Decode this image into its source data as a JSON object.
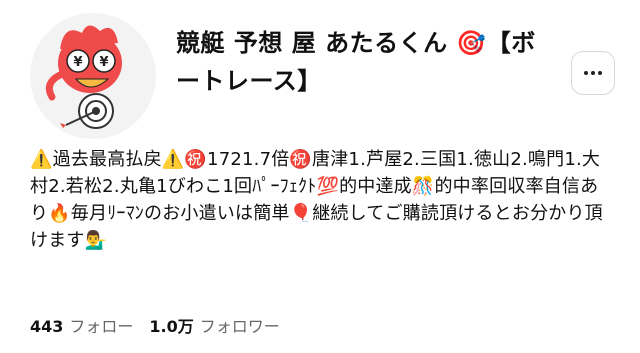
{
  "profile": {
    "name": "競艇 予想 屋 あたるくん 🎯【ボートレース】",
    "bio": "⚠️過去最高払戻⚠️㊗️1721.7倍㊗️唐津1.芦屋2.三国1.徳山2.鳴門1.大村2.若松2.丸亀1びわこ1回ﾊﾟｰﾌｪｸﾄ💯的中達成🎊的中率回収率自信あり🔥毎月ﾘｰﾏﾝのお小遣いは簡単🎈継続してご購読頂けるとお分かり頂けます💁‍♂️",
    "avatar_icon": "mascot-avatar-icon",
    "more_icon": "more-horizontal-icon"
  },
  "stats": {
    "following_count": "443",
    "following_label": "フォロー",
    "followers_count": "1.0万",
    "followers_label": "フォロワー"
  }
}
